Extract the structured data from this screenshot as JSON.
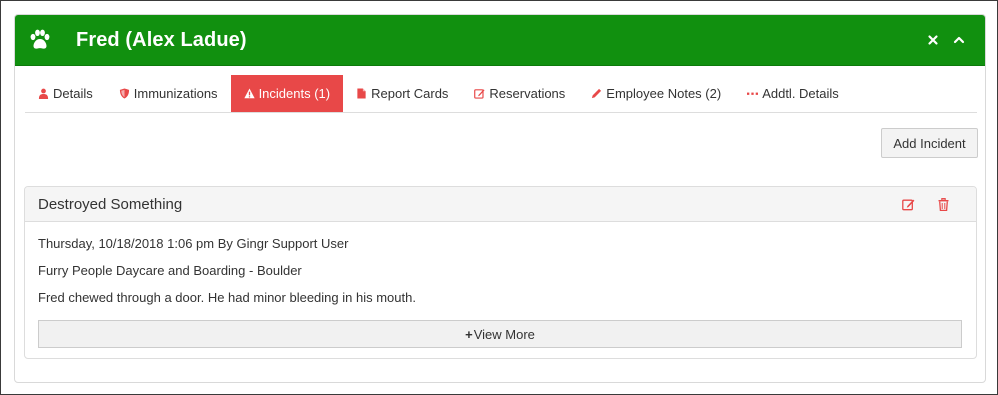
{
  "panel": {
    "title": "Fred (Alex Ladue)",
    "header_color": "#11900f",
    "icons": [
      "paw-icon",
      "close-icon",
      "chevron-up-icon"
    ]
  },
  "tabs": [
    {
      "label": "Details",
      "icon": "user-icon",
      "active": false
    },
    {
      "label": "Immunizations",
      "icon": "shield-icon",
      "active": false
    },
    {
      "label": "Incidents (1)",
      "icon": "warning-icon",
      "active": true
    },
    {
      "label": "Report Cards",
      "icon": "file-icon",
      "active": false
    },
    {
      "label": "Reservations",
      "icon": "edit-icon",
      "active": false
    },
    {
      "label": "Employee Notes (2)",
      "icon": "pencil-icon",
      "active": false
    },
    {
      "label": "Addtl. Details",
      "icon": "ellipsis-icon",
      "active": false
    }
  ],
  "active_tab_color": "#e84848",
  "add_button": {
    "label": "Add Incident"
  },
  "incident": {
    "title": "Destroyed Something",
    "datetime_line": "Thursday, 10/18/2018 1:06 pm By Gingr Support User",
    "location": "Furry People Daycare and Boarding - Boulder",
    "description": "Fred chewed through a door. He had minor bleeding in his mouth.",
    "view_more_label": "View More",
    "actions": [
      "edit-icon",
      "trash-icon"
    ]
  }
}
